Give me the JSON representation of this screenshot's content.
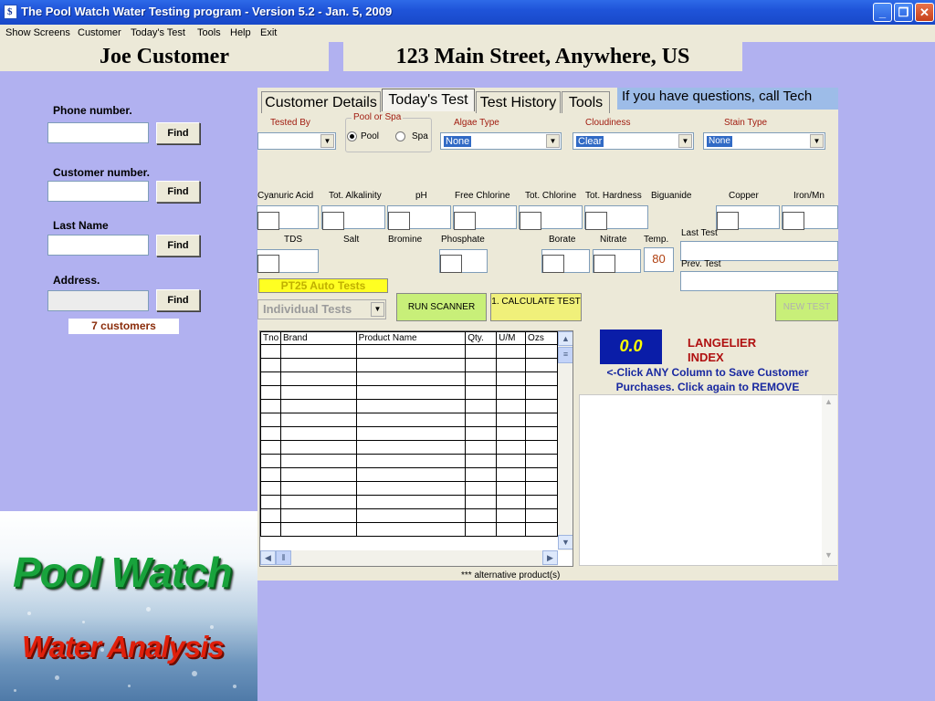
{
  "window": {
    "title": "The Pool Watch Water Testing program - Version 5.2 - Jan. 5, 2009",
    "icon_char": "$"
  },
  "window_controls": {
    "minimize": "_",
    "restore": "❐",
    "close": "✕"
  },
  "menu": [
    "Show Screens",
    "Customer",
    "Today's Test",
    "Tools",
    "Help",
    "Exit"
  ],
  "header": {
    "customer_name": "Joe Customer",
    "address": "123 Main Street, Anywhere, US"
  },
  "search": {
    "phone_label": "Phone number.",
    "customer_label": "Customer number.",
    "lastname_label": "Last Name",
    "address_label": "Address.",
    "find_label": "Find",
    "count": "7 customers"
  },
  "logo": {
    "line1": "Pool Watch",
    "line2": "Water Analysis"
  },
  "tabs": [
    "Customer Details",
    "Today's Test",
    "Test History",
    "Tools"
  ],
  "active_tab": "Today's Test",
  "call_note": "If you have questions, call Tech",
  "top_fields": {
    "tested_by": "Tested By",
    "pool_or_spa": "Pool or Spa",
    "pool": "Pool",
    "spa": "Spa",
    "algae_type": "Algae Type",
    "algae_value": "None",
    "cloudiness": "Cloudiness",
    "cloudiness_value": "Clear",
    "stain_type": "Stain Type",
    "stain_value": "None"
  },
  "chem_labels": [
    "Cyanuric Acid",
    "Tot. Alkalinity",
    "pH",
    "Free Chlorine",
    "Tot. Chlorine",
    "Tot. Hardness",
    "Biguanide",
    "Copper",
    "Iron/Mn"
  ],
  "chem_labels2": [
    "TDS",
    "Salt",
    "Bromine",
    "Phosphate",
    "Borate",
    "Nitrate",
    "Temp."
  ],
  "temp_value": "80",
  "last_test_label": "Last Test",
  "prev_test_label": "Prev. Test",
  "buttons": {
    "pt25": "PT25 Auto Tests",
    "individual": "Individual Tests",
    "run_scanner": "RUN SCANNER",
    "calculate": "1.  CALCULATE TEST",
    "new_test": "NEW TEST"
  },
  "grid_columns": [
    "Tno",
    "Brand",
    "Product Name",
    "Qty.",
    "U/M",
    "Ozs"
  ],
  "lsi": {
    "value": "0.0",
    "label1": "LANGELIER",
    "label2": "INDEX"
  },
  "purchase_note": "<-Click ANY Column to Save Customer Purchases.  Click again to REMOVE",
  "footer_note": "***  alternative product(s)",
  "colors": {
    "title_bar": "#1f54d9",
    "panel": "#ece9d8",
    "background": "#b1b1f0",
    "lsi_box": "#0a1da8",
    "calc_button": "#f0f07a",
    "scan_button": "#c8ef79"
  }
}
